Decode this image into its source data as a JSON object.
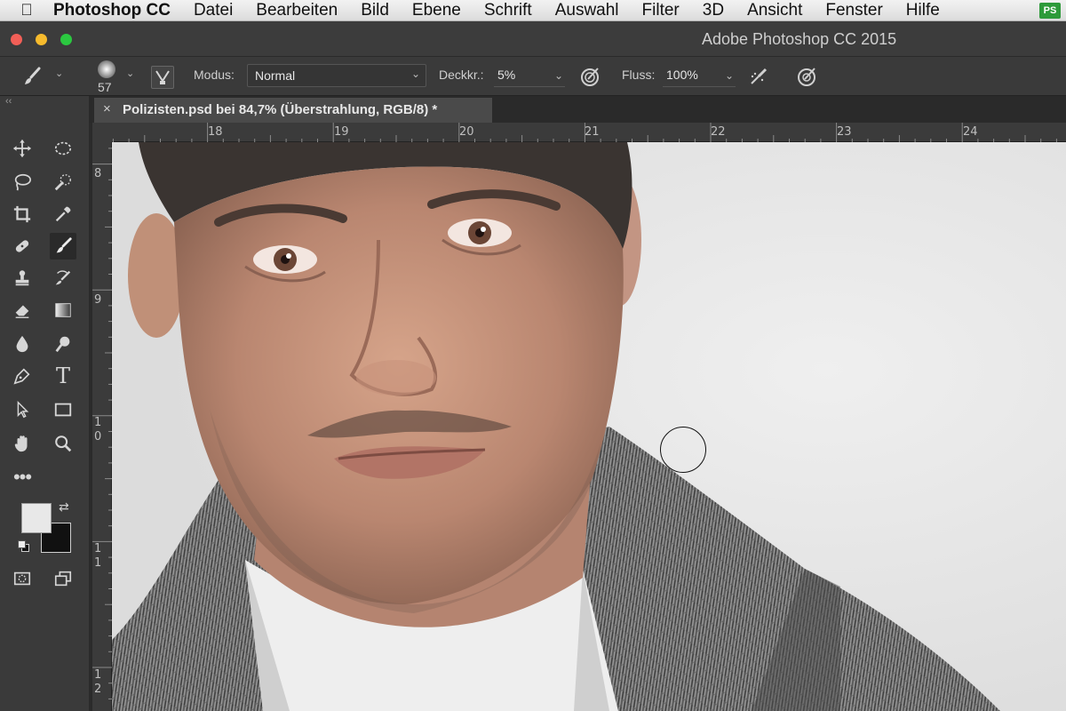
{
  "menubar": {
    "app_name": "Photoshop CC",
    "items": [
      "Datei",
      "Bearbeiten",
      "Bild",
      "Ebene",
      "Schrift",
      "Auswahl",
      "Filter",
      "3D",
      "Ansicht",
      "Fenster",
      "Hilfe"
    ]
  },
  "window": {
    "title": "Adobe Photoshop CC 2015"
  },
  "options": {
    "brush_size": "57",
    "mode_label": "Modus:",
    "mode_value": "Normal",
    "opacity_label": "Deckkr.:",
    "opacity_value": "5%",
    "flow_label": "Fluss:",
    "flow_value": "100%"
  },
  "document": {
    "tab_title": "Polizisten.psd bei 84,7% (Überstrahlung, RGB/8) *"
  },
  "rulers": {
    "top_labels": [
      "18",
      "19",
      "20",
      "21",
      "22",
      "23",
      "24"
    ],
    "left_labels": [
      "8",
      "9",
      "1\n0",
      "1\n1",
      "1\n2"
    ]
  },
  "colors": {
    "foreground": "#e8e8e8",
    "background": "#111111"
  }
}
